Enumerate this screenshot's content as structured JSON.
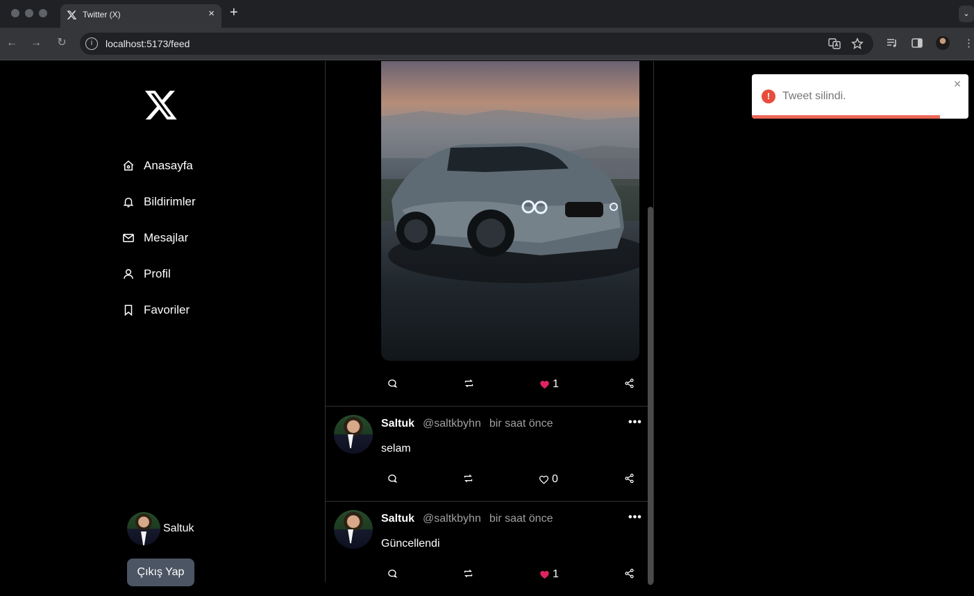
{
  "browser": {
    "tab_title": "Twitter (X)",
    "url": "localhost:5173/feed",
    "new_tab_label": "+",
    "tab_close_label": "×",
    "tab_menu_label": "⌄"
  },
  "sidebar": {
    "items": [
      {
        "label": "Anasayfa",
        "icon": "home-icon"
      },
      {
        "label": "Bildirimler",
        "icon": "bell-icon"
      },
      {
        "label": "Mesajlar",
        "icon": "mail-icon"
      },
      {
        "label": "Profil",
        "icon": "user-icon"
      },
      {
        "label": "Favoriler",
        "icon": "bookmark-icon"
      }
    ],
    "user_name": "Saltuk",
    "logout_label": "Çıkış Yap"
  },
  "feed": {
    "first_tweet": {
      "likes": "1",
      "liked": true
    },
    "tweets": [
      {
        "name": "Saltuk",
        "handle": "@saltkbyhn",
        "time": "bir saat önce",
        "text": "selam",
        "likes": "0",
        "liked": false
      },
      {
        "name": "Saltuk",
        "handle": "@saltkbyhn",
        "time": "bir saat önce",
        "text": "Güncellendi",
        "likes": "1",
        "liked": true
      }
    ],
    "more_label": "•••"
  },
  "toast": {
    "message": "Tweet silindi.",
    "close_label": "✕",
    "icon_label": "!",
    "progress": 0.87
  },
  "colors": {
    "like_red": "#e0245e",
    "toast_red": "#e74c3c",
    "logout_bg": "#4b5563"
  }
}
